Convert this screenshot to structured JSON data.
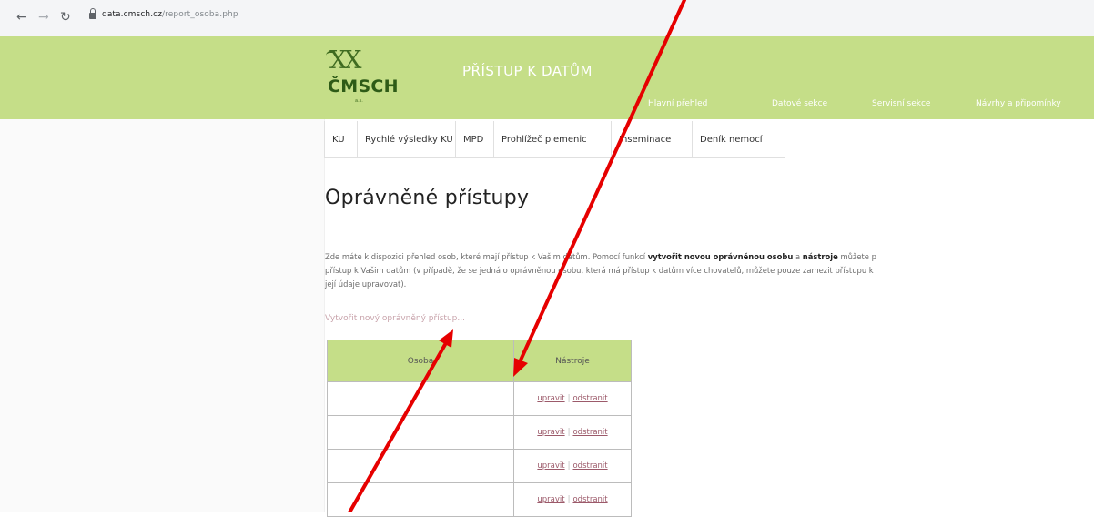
{
  "browser": {
    "url_host": "data.cmsch.cz",
    "url_path": "/report_osoba.php"
  },
  "header": {
    "logo_mark": "XX",
    "logo_text": "ČMSCH",
    "logo_sub": "a.s.",
    "site_title": "PŘÍSTUP K DATŮM",
    "nav": [
      "Hlavní přehled",
      "Datové sekce",
      "Servisní sekce",
      "Návrhy a připomínky"
    ]
  },
  "tabs": [
    "KU",
    "Rychlé výsledky KU",
    "MPD",
    "Prohlížeč plemenic",
    "Inseminace",
    "Deník nemocí"
  ],
  "page": {
    "title": "Oprávněné přístupy",
    "intro_1a": "Zde máte k dispozici přehled osob, které mají přístup k Vašim datům. Pomocí funkcí ",
    "intro_1b": "vytvořit novou oprávněnou osobu",
    "intro_1c": " a ",
    "intro_1d": "nástroje",
    "intro_1e": " můžete p",
    "intro_2": "přístup k Vašim datům (v případě, že se jedná o oprávněnou osobu, která má přístup k datům více chovatelů, můžete pouze zamezit přístupu k",
    "intro_3": "její údaje upravovat).",
    "new_access_link": "Vytvořit nový oprávněný přístup..."
  },
  "table": {
    "headers": [
      "Osoba",
      "Nástroje"
    ],
    "rows": [
      {
        "osoba": "",
        "edit": "upravit",
        "remove": "odstranit"
      },
      {
        "osoba": "",
        "edit": "upravit",
        "remove": "odstranit"
      },
      {
        "osoba": "",
        "edit": "upravit",
        "remove": "odstranit"
      },
      {
        "osoba": "",
        "edit": "upravit",
        "remove": "odstranit"
      }
    ],
    "separator": "|"
  },
  "annotations": {
    "arrow_color": "#e60000"
  },
  "colors": {
    "header_green": "#c5de88",
    "logo_green": "#2e5b17",
    "link_color": "#9c5a6a"
  }
}
